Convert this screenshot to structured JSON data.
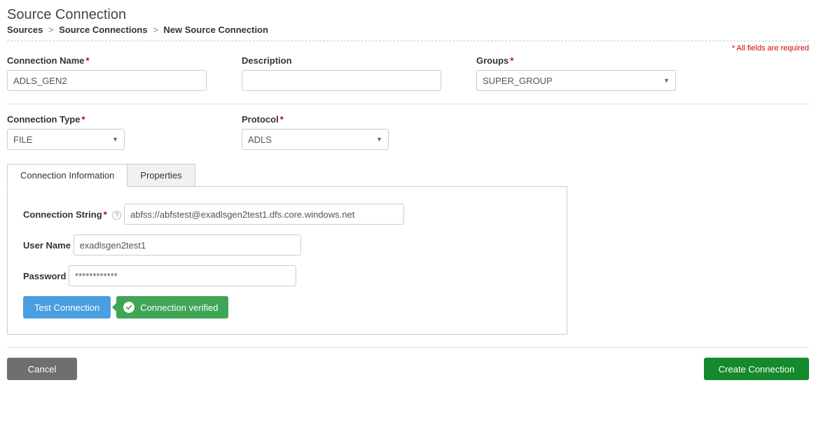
{
  "header": {
    "title": "Source Connection",
    "breadcrumb": {
      "item1": "Sources",
      "item2": "Source Connections",
      "item3": "New Source Connection",
      "sep": ">"
    },
    "required_note": "All fields are required"
  },
  "form": {
    "connection_name": {
      "label": "Connection Name",
      "value": "ADLS_GEN2"
    },
    "description": {
      "label": "Description",
      "value": ""
    },
    "groups": {
      "label": "Groups",
      "value": "SUPER_GROUP"
    },
    "connection_type": {
      "label": "Connection Type",
      "value": "FILE"
    },
    "protocol": {
      "label": "Protocol",
      "value": "ADLS"
    }
  },
  "tabs": {
    "connection_information": "Connection Information",
    "properties": "Properties"
  },
  "connection_info": {
    "connection_string": {
      "label": "Connection String",
      "value": "abfss://abfstest@exadlsgen2test1.dfs.core.windows.net"
    },
    "user_name": {
      "label": "User Name",
      "value": "exadlsgen2test1"
    },
    "password": {
      "label": "Password",
      "value": "************"
    },
    "test_button": "Test Connection",
    "status": "Connection verified"
  },
  "footer": {
    "cancel": "Cancel",
    "create": "Create Connection"
  }
}
